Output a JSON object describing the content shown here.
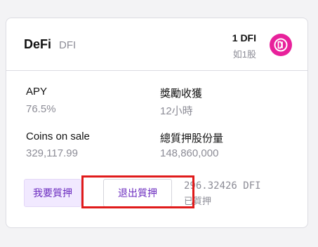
{
  "header": {
    "name": "DeFi",
    "symbol": "DFI",
    "price_main": "1 DFI",
    "price_sub": "如1股",
    "logo_icon": "defichain-logo-icon",
    "logo_color": "#e8219b"
  },
  "stats": {
    "apy_label": "APY",
    "apy_value": "76.5%",
    "reward_label": "獎勵收獲",
    "reward_value": "12小時",
    "coins_label": "Coins on sale",
    "coins_value": "329,117.99",
    "total_label": "總質押股份量",
    "total_value": "148,860,000"
  },
  "actions": {
    "stake_label": "我要質押",
    "unstake_label": "退出質押",
    "staked_amount": "296.32426 DFI",
    "staked_label": "已質押"
  },
  "colors": {
    "accent": "#6b2bbf",
    "highlight": "#e01b1b"
  }
}
